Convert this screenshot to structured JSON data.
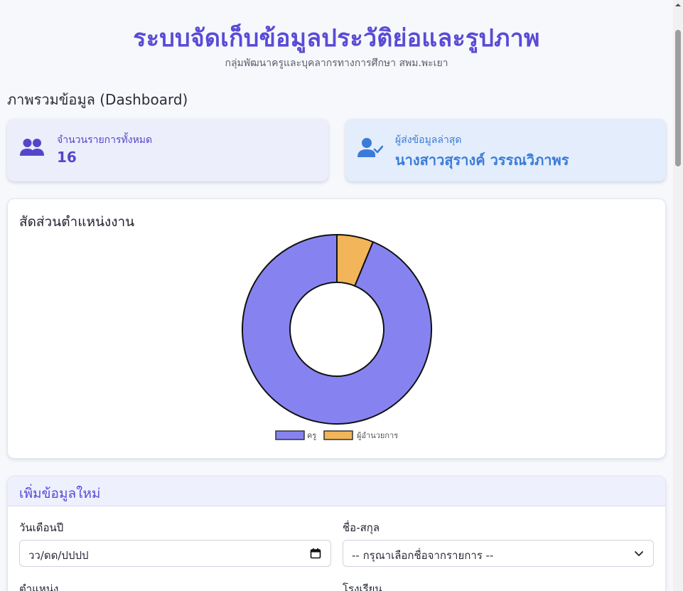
{
  "header": {
    "title": "ระบบจัดเก็บข้อมูลประวัติย่อและรูปภาพ",
    "subtitle": "กลุ่มพัฒนาครูและบุคลากรทางการศึกษา สพม.พะเยา"
  },
  "dashboard": {
    "heading": "ภาพรวมข้อมูล (Dashboard)",
    "total_card": {
      "label": "จำนวนรายการทั้งหมด",
      "value": "16",
      "icon": "users-icon",
      "color": "#5546c9"
    },
    "latest_card": {
      "label": "ผู้ส่งข้อมูลล่าสุด",
      "value": "นางสาวสุรางค์ วรรณวิภาพร",
      "icon": "user-check-icon",
      "color": "#3a7bd8"
    }
  },
  "chart_card": {
    "title": "สัดส่วนตำแหน่งงาน"
  },
  "chart_data": {
    "type": "pie",
    "donut": true,
    "categories": [
      "ครู",
      "ผู้อำนวยการ"
    ],
    "values": [
      15,
      1
    ],
    "colors": [
      "#8683f1",
      "#f3b55a"
    ],
    "legend": "bottom"
  },
  "form": {
    "title": "เพิ่มข้อมูลใหม่",
    "date_label": "วันเดือนปี",
    "date_placeholder": "วว/ดด/ปปปป",
    "name_label": "ชื่อ-สกุล",
    "name_selected": "-- กรุณาเลือกชื่อจากรายการ --",
    "position_label": "ตำแหน่ง",
    "school_label": "โรงเรียน"
  }
}
